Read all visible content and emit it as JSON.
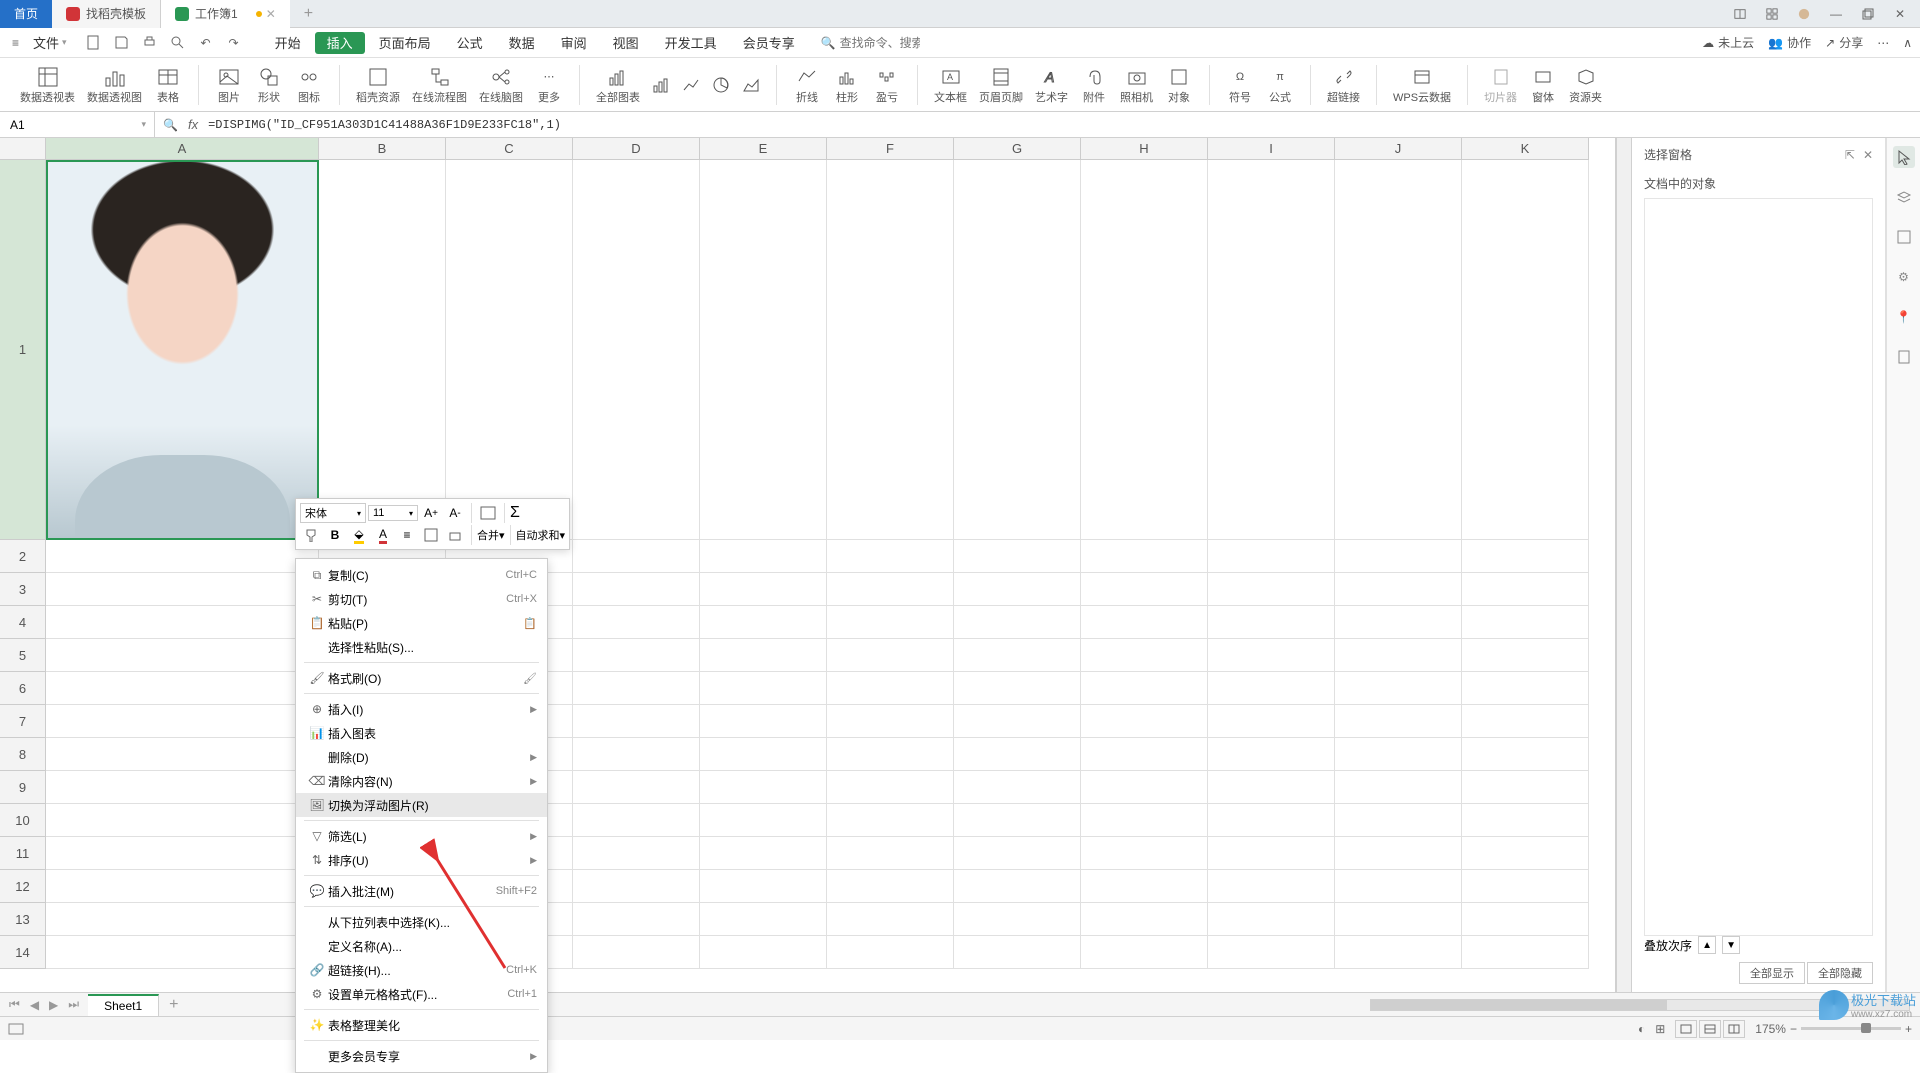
{
  "titlebar": {
    "home": "首页",
    "templates": "找稻壳模板",
    "doc": "工作簿1"
  },
  "menubar": {
    "file": "文件",
    "tabs": [
      "开始",
      "插入",
      "页面布局",
      "公式",
      "数据",
      "审阅",
      "视图",
      "开发工具",
      "会员专享"
    ],
    "active_tab_index": 1,
    "search_placeholder": "查找命令、搜索模板",
    "cloud": "未上云",
    "coop": "协作",
    "share": "分享"
  },
  "ribbon": {
    "items": [
      "数据透视表",
      "数据透视图",
      "表格",
      "图片",
      "形状",
      "图标",
      "稻壳资源",
      "在线流程图",
      "在线脑图",
      "更多",
      "全部图表",
      "",
      "",
      "",
      "",
      "折线",
      "柱形",
      "盈亏",
      "文本框",
      "页眉页脚",
      "艺术字",
      "附件",
      "照相机",
      "对象",
      "符号",
      "公式",
      "超链接",
      "WPS云数据",
      "切片器",
      "窗体",
      "资源夹"
    ]
  },
  "cell": {
    "ref": "A1",
    "formula": "=DISPIMG(\"ID_CF951A303D1C41488A36F1D9E233FC18\",1)"
  },
  "columns": [
    "A",
    "B",
    "C",
    "D",
    "E",
    "F",
    "G",
    "H",
    "I",
    "J",
    "K"
  ],
  "rows": [
    "1",
    "2",
    "3",
    "4",
    "5",
    "6",
    "7",
    "8",
    "9",
    "10",
    "11",
    "12",
    "13",
    "14"
  ],
  "mini": {
    "font": "宋体",
    "size": "11",
    "merge": "合并",
    "sum": "自动求和"
  },
  "context_menu": {
    "items": [
      {
        "icon": "copy",
        "text": "复制(C)",
        "shortcut": "Ctrl+C"
      },
      {
        "icon": "cut",
        "text": "剪切(T)",
        "shortcut": "Ctrl+X"
      },
      {
        "icon": "paste",
        "text": "粘贴(P)",
        "shortcut": "",
        "extra": "clip"
      },
      {
        "icon": "",
        "text": "选择性粘贴(S)...",
        "shortcut": ""
      },
      {
        "sep": true
      },
      {
        "icon": "brush",
        "text": "格式刷(O)",
        "shortcut": "",
        "extra": "brush"
      },
      {
        "sep": true
      },
      {
        "icon": "insert",
        "text": "插入(I)",
        "arrow": true
      },
      {
        "icon": "chart",
        "text": "插入图表",
        "shortcut": ""
      },
      {
        "icon": "",
        "text": "删除(D)",
        "arrow": true
      },
      {
        "icon": "clear",
        "text": "清除内容(N)",
        "arrow": true
      },
      {
        "icon": "float",
        "text": "切换为浮动图片(R)",
        "shortcut": "",
        "hover": true
      },
      {
        "sep": true
      },
      {
        "icon": "filter",
        "text": "筛选(L)",
        "arrow": true
      },
      {
        "icon": "sort",
        "text": "排序(U)",
        "arrow": true
      },
      {
        "sep": true
      },
      {
        "icon": "comment",
        "text": "插入批注(M)",
        "shortcut": "Shift+F2"
      },
      {
        "sep": true
      },
      {
        "icon": "",
        "text": "从下拉列表中选择(K)...",
        "shortcut": ""
      },
      {
        "icon": "",
        "text": "定义名称(A)...",
        "shortcut": ""
      },
      {
        "icon": "link",
        "text": "超链接(H)...",
        "shortcut": "Ctrl+K"
      },
      {
        "icon": "format",
        "text": "设置单元格格式(F)...",
        "shortcut": "Ctrl+1"
      },
      {
        "sep": true
      },
      {
        "icon": "beautify",
        "text": "表格整理美化",
        "shortcut": ""
      },
      {
        "sep": true
      },
      {
        "icon": "",
        "text": "更多会员专享",
        "arrow": true
      }
    ]
  },
  "selection_pane": {
    "title": "选择窗格",
    "subtitle": "文档中的对象",
    "order": "叠放次序",
    "show_all": "全部显示",
    "hide_all": "全部隐藏"
  },
  "sheet": {
    "name": "Sheet1"
  },
  "status": {
    "zoom": "175%"
  }
}
